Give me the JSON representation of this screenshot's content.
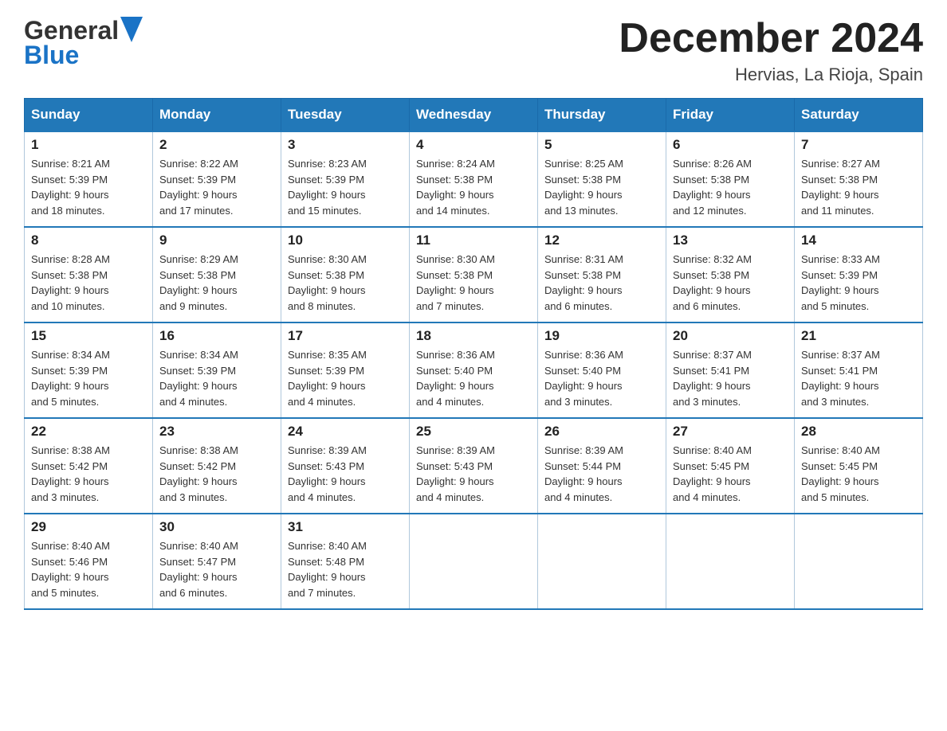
{
  "header": {
    "logo_general": "General",
    "logo_blue": "Blue",
    "month_title": "December 2024",
    "location": "Hervias, La Rioja, Spain"
  },
  "weekdays": [
    "Sunday",
    "Monday",
    "Tuesday",
    "Wednesday",
    "Thursday",
    "Friday",
    "Saturday"
  ],
  "weeks": [
    [
      {
        "day": "1",
        "sunrise": "8:21 AM",
        "sunset": "5:39 PM",
        "daylight": "9 hours and 18 minutes."
      },
      {
        "day": "2",
        "sunrise": "8:22 AM",
        "sunset": "5:39 PM",
        "daylight": "9 hours and 17 minutes."
      },
      {
        "day": "3",
        "sunrise": "8:23 AM",
        "sunset": "5:39 PM",
        "daylight": "9 hours and 15 minutes."
      },
      {
        "day": "4",
        "sunrise": "8:24 AM",
        "sunset": "5:38 PM",
        "daylight": "9 hours and 14 minutes."
      },
      {
        "day": "5",
        "sunrise": "8:25 AM",
        "sunset": "5:38 PM",
        "daylight": "9 hours and 13 minutes."
      },
      {
        "day": "6",
        "sunrise": "8:26 AM",
        "sunset": "5:38 PM",
        "daylight": "9 hours and 12 minutes."
      },
      {
        "day": "7",
        "sunrise": "8:27 AM",
        "sunset": "5:38 PM",
        "daylight": "9 hours and 11 minutes."
      }
    ],
    [
      {
        "day": "8",
        "sunrise": "8:28 AM",
        "sunset": "5:38 PM",
        "daylight": "9 hours and 10 minutes."
      },
      {
        "day": "9",
        "sunrise": "8:29 AM",
        "sunset": "5:38 PM",
        "daylight": "9 hours and 9 minutes."
      },
      {
        "day": "10",
        "sunrise": "8:30 AM",
        "sunset": "5:38 PM",
        "daylight": "9 hours and 8 minutes."
      },
      {
        "day": "11",
        "sunrise": "8:30 AM",
        "sunset": "5:38 PM",
        "daylight": "9 hours and 7 minutes."
      },
      {
        "day": "12",
        "sunrise": "8:31 AM",
        "sunset": "5:38 PM",
        "daylight": "9 hours and 6 minutes."
      },
      {
        "day": "13",
        "sunrise": "8:32 AM",
        "sunset": "5:38 PM",
        "daylight": "9 hours and 6 minutes."
      },
      {
        "day": "14",
        "sunrise": "8:33 AM",
        "sunset": "5:39 PM",
        "daylight": "9 hours and 5 minutes."
      }
    ],
    [
      {
        "day": "15",
        "sunrise": "8:34 AM",
        "sunset": "5:39 PM",
        "daylight": "9 hours and 5 minutes."
      },
      {
        "day": "16",
        "sunrise": "8:34 AM",
        "sunset": "5:39 PM",
        "daylight": "9 hours and 4 minutes."
      },
      {
        "day": "17",
        "sunrise": "8:35 AM",
        "sunset": "5:39 PM",
        "daylight": "9 hours and 4 minutes."
      },
      {
        "day": "18",
        "sunrise": "8:36 AM",
        "sunset": "5:40 PM",
        "daylight": "9 hours and 4 minutes."
      },
      {
        "day": "19",
        "sunrise": "8:36 AM",
        "sunset": "5:40 PM",
        "daylight": "9 hours and 3 minutes."
      },
      {
        "day": "20",
        "sunrise": "8:37 AM",
        "sunset": "5:41 PM",
        "daylight": "9 hours and 3 minutes."
      },
      {
        "day": "21",
        "sunrise": "8:37 AM",
        "sunset": "5:41 PM",
        "daylight": "9 hours and 3 minutes."
      }
    ],
    [
      {
        "day": "22",
        "sunrise": "8:38 AM",
        "sunset": "5:42 PM",
        "daylight": "9 hours and 3 minutes."
      },
      {
        "day": "23",
        "sunrise": "8:38 AM",
        "sunset": "5:42 PM",
        "daylight": "9 hours and 3 minutes."
      },
      {
        "day": "24",
        "sunrise": "8:39 AM",
        "sunset": "5:43 PM",
        "daylight": "9 hours and 4 minutes."
      },
      {
        "day": "25",
        "sunrise": "8:39 AM",
        "sunset": "5:43 PM",
        "daylight": "9 hours and 4 minutes."
      },
      {
        "day": "26",
        "sunrise": "8:39 AM",
        "sunset": "5:44 PM",
        "daylight": "9 hours and 4 minutes."
      },
      {
        "day": "27",
        "sunrise": "8:40 AM",
        "sunset": "5:45 PM",
        "daylight": "9 hours and 4 minutes."
      },
      {
        "day": "28",
        "sunrise": "8:40 AM",
        "sunset": "5:45 PM",
        "daylight": "9 hours and 5 minutes."
      }
    ],
    [
      {
        "day": "29",
        "sunrise": "8:40 AM",
        "sunset": "5:46 PM",
        "daylight": "9 hours and 5 minutes."
      },
      {
        "day": "30",
        "sunrise": "8:40 AM",
        "sunset": "5:47 PM",
        "daylight": "9 hours and 6 minutes."
      },
      {
        "day": "31",
        "sunrise": "8:40 AM",
        "sunset": "5:48 PM",
        "daylight": "9 hours and 7 minutes."
      },
      null,
      null,
      null,
      null
    ]
  ],
  "labels": {
    "sunrise": "Sunrise:",
    "sunset": "Sunset:",
    "daylight": "Daylight:"
  }
}
